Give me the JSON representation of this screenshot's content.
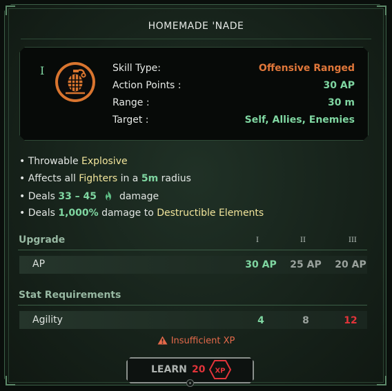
{
  "title": "HOMEMADE 'NADE",
  "skill": {
    "tier": "I",
    "icon": "grenade-icon",
    "stats": [
      {
        "label": "Skill Type:",
        "value": "Offensive Ranged",
        "color": "#e0773a"
      },
      {
        "label": "Action Points :",
        "value": "30 AP",
        "color": "#7fd6a1"
      },
      {
        "label": "Range :",
        "value": "30 m",
        "color": "#7fd6a1"
      },
      {
        "label": "Target :",
        "value": "Self, Allies, Enemies",
        "color": "#7fd6a1"
      }
    ]
  },
  "description": {
    "line1": {
      "bullet": "•",
      "text": "Throwable",
      "highlight": "Explosive"
    },
    "line2": {
      "bullet": "•",
      "text_a": "Affects all",
      "highlight_a": "Fighters",
      "text_b": "in a",
      "highlight_b": "5m",
      "text_c": "radius"
    },
    "line3": {
      "bullet": "•",
      "text_a": "Deals",
      "highlight": "33 – 45",
      "icon": "fire-icon",
      "text_b": "damage"
    },
    "line4": {
      "bullet": "•",
      "text_a": "Deals",
      "highlight_a": "1,000%",
      "text_b": "damage to",
      "highlight_b": "Destructible Elements"
    }
  },
  "upgrade": {
    "heading": "Upgrade",
    "levels": [
      "I",
      "II",
      "III"
    ],
    "row": {
      "label": "AP",
      "values": [
        "30 AP",
        "25 AP",
        "20 AP"
      ]
    }
  },
  "requirements": {
    "heading": "Stat Requirements",
    "row": {
      "label": "Agility",
      "values": [
        "4",
        "8",
        "12"
      ]
    }
  },
  "warning": {
    "icon": "warning-icon",
    "text": "Insufficient XP"
  },
  "learn": {
    "label": "LEARN",
    "cost": "20",
    "currency": "XP"
  },
  "colors": {
    "accent_green": "#7fd6a1",
    "accent_orange": "#e0773a",
    "highlight_yellow": "#f2e59b",
    "alert_red": "#e2343a"
  }
}
